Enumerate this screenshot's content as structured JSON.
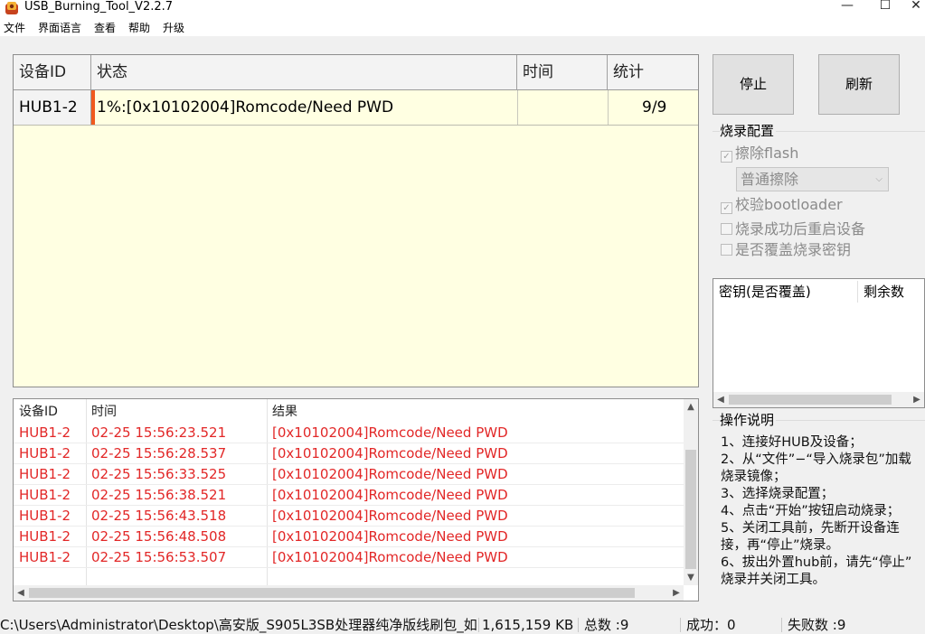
{
  "window": {
    "title": "USB_Burning_Tool_V2.2.7",
    "minimize_glyph": "—",
    "maximize_glyph": "☐",
    "close_glyph": "✕"
  },
  "menu": [
    "文件",
    "界面语言",
    "查看",
    "帮助",
    "升级"
  ],
  "device_grid": {
    "columns": [
      "设备ID",
      "状态",
      "时间",
      "统计"
    ],
    "rows": [
      {
        "device_id": "HUB1-2",
        "status": "1%:[0x10102004]Romcode/Need PWD",
        "time": "",
        "count": "9/9",
        "progress_percent": 1,
        "progress_color": "#f05a1e"
      }
    ]
  },
  "log": {
    "columns": [
      "设备ID",
      "时间",
      "结果"
    ],
    "rows": [
      {
        "device_id": "HUB1-2",
        "time": "02-25 15:56:23.521",
        "result": "[0x10102004]Romcode/Need PWD"
      },
      {
        "device_id": "HUB1-2",
        "time": "02-25 15:56:28.537",
        "result": "[0x10102004]Romcode/Need PWD"
      },
      {
        "device_id": "HUB1-2",
        "time": "02-25 15:56:33.525",
        "result": "[0x10102004]Romcode/Need PWD"
      },
      {
        "device_id": "HUB1-2",
        "time": "02-25 15:56:38.521",
        "result": "[0x10102004]Romcode/Need PWD"
      },
      {
        "device_id": "HUB1-2",
        "time": "02-25 15:56:43.518",
        "result": "[0x10102004]Romcode/Need PWD"
      },
      {
        "device_id": "HUB1-2",
        "time": "02-25 15:56:48.508",
        "result": "[0x10102004]Romcode/Need PWD"
      },
      {
        "device_id": "HUB1-2",
        "time": "02-25 15:56:53.507",
        "result": "[0x10102004]Romcode/Need PWD"
      }
    ],
    "text_color": "#e22727"
  },
  "buttons": {
    "stop": "停止",
    "refresh": "刷新"
  },
  "burn_config": {
    "title": "烧录配置",
    "erase_flash": {
      "label": "擦除flash",
      "checked": true,
      "enabled": false
    },
    "erase_mode": {
      "value": "普通擦除",
      "enabled": false
    },
    "verify_bootloader": {
      "label": "校验bootloader",
      "checked": true,
      "enabled": false
    },
    "reboot_after_success": {
      "label": "烧录成功后重启设备",
      "checked": false,
      "enabled": false
    },
    "overwrite_key": {
      "label": "是否覆盖烧录密钥",
      "checked": false,
      "enabled": false
    }
  },
  "key_table": {
    "columns": [
      "密钥(是否覆盖)",
      "剩余数"
    ]
  },
  "instructions": {
    "title": "操作说明",
    "text": "1、连接好HUB及设备；\n2、从“文件”−“导入烧录包”加载\n烧录镜像；\n3、选择烧录配置；\n4、点击“开始”按钮启动烧录；\n5、关闭工具前，先断开设备连\n接，再“停止”烧录。\n6、拔出外置hub前，请先“停止”\n烧录并关闭工具。"
  },
  "status_bar": {
    "path": "C:\\Users\\Administrator\\Desktop\\高安版_S905L3SB处理器纯净版线刷包_如",
    "size": "1,615,159 KB",
    "total": "总数 :9",
    "success": "成功：0",
    "fail": "失败数 :9"
  }
}
